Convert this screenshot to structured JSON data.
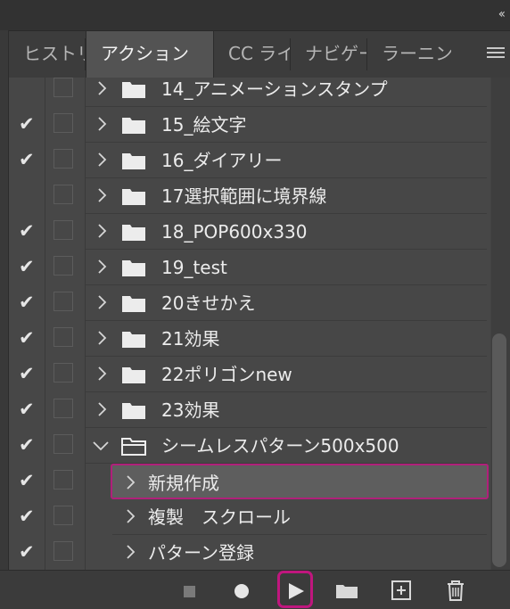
{
  "panel": {
    "tabs": [
      {
        "label": "ヒストリー",
        "active": false
      },
      {
        "label": "アクション",
        "active": true
      },
      {
        "label": "CC ライブラリ",
        "active": false
      },
      {
        "label": "ナビゲーター",
        "active": false
      },
      {
        "label": "ラーニング",
        "active": false
      }
    ],
    "collapse_icon": "double-chevron-left-icon",
    "menu_icon": "panel-menu-icon"
  },
  "actions": {
    "sets": [
      {
        "label": "14_アニメーションスタンプ",
        "checked": false,
        "expanded": false
      },
      {
        "label": "15_絵文字",
        "checked": true,
        "expanded": false
      },
      {
        "label": "16_ダイアリー",
        "checked": true,
        "expanded": false
      },
      {
        "label": "17選択範囲に境界線",
        "checked": false,
        "expanded": false
      },
      {
        "label": "18_POP600x330",
        "checked": true,
        "expanded": false
      },
      {
        "label": "19_test",
        "checked": true,
        "expanded": false
      },
      {
        "label": "20きせかえ",
        "checked": true,
        "expanded": false
      },
      {
        "label": "21効果",
        "checked": true,
        "expanded": false
      },
      {
        "label": "22ポリゴンnew",
        "checked": true,
        "expanded": false
      },
      {
        "label": "23効果",
        "checked": true,
        "expanded": false
      },
      {
        "label": "シームレスパターン500x500",
        "checked": true,
        "expanded": true
      }
    ],
    "steps": [
      {
        "label": "新規作成",
        "checked": true,
        "selected": true
      },
      {
        "label": "複製　スクロール",
        "checked": true,
        "selected": false
      },
      {
        "label": "パターン登録",
        "checked": true,
        "selected": false
      }
    ]
  },
  "toolbar": {
    "buttons": [
      "stop-icon",
      "record-icon",
      "play-icon",
      "new-set-icon",
      "new-action-icon",
      "trash-icon"
    ],
    "highlight": "play-icon",
    "highlight_color": "#c0167e"
  },
  "colors": {
    "panel_bg": "#474747",
    "selection_border": "#b0207a",
    "text": "#ececec"
  }
}
